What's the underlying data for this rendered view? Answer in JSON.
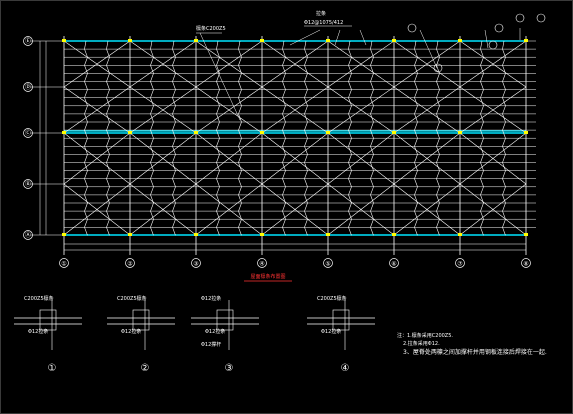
{
  "drawing": {
    "title": "屋面檩条布置图",
    "grid_columns": [
      "①",
      "②",
      "③",
      "④",
      "⑤",
      "⑥",
      "⑦",
      "⑧"
    ],
    "grid_rows": [
      "Ⓐ",
      "Ⓑ",
      "Ⓒ",
      "Ⓓ",
      "Ⓔ"
    ],
    "top_labels": {
      "purlin": "檩条C200Z5",
      "tie_rod": "拉条",
      "tie_rod_spec": "Φ12@1075/412"
    },
    "details": [
      {
        "number": "①",
        "labels": [
          "C200Z5檩条",
          "Φ12拉条"
        ]
      },
      {
        "number": "②",
        "labels": [
          "C200Z5檩条",
          "Φ12拉条"
        ]
      },
      {
        "number": "③",
        "labels": [
          "Φ12拉条",
          "Φ12拉条",
          "Φ12撑杆"
        ]
      },
      {
        "number": "④",
        "labels": [
          "C200Z5檩条",
          "Φ12拉条"
        ]
      }
    ],
    "notes": [
      "注：1.檩条采用C200Z5.",
      "2.拉条采用Φ12.",
      "3、屋脊处两檩之间加撑杆并用钢板连接后焊接在一起."
    ]
  },
  "colors": {
    "background": "#000000",
    "lines": "#ffffff",
    "purlin_main": "#00e5ff",
    "grid_bubble": "#ffffff",
    "node": "#ffff00",
    "title": "#ff3333"
  }
}
